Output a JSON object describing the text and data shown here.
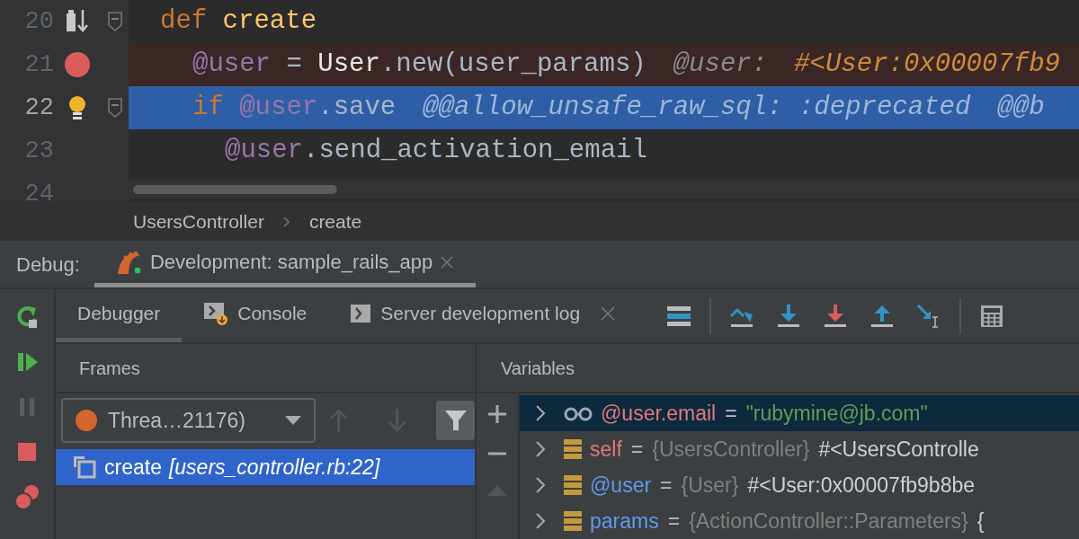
{
  "editor": {
    "lines": [
      {
        "number": "20",
        "kind": "execution-point",
        "current": false,
        "breakpoint": false,
        "foldable": true,
        "tokens": [
          {
            "kind": "keyword",
            "text": "def"
          },
          {
            "kind": "method",
            "text": " create"
          }
        ],
        "children": [
          {
            "number": "21",
            "current": false,
            "breakpoint": true,
            "foldable": false,
            "tokens": [
              {
                "kind": "ivar",
                "text": "@user"
              },
              {
                "kind": "plain",
                "text": " = "
              },
              {
                "kind": "const",
                "text": "User"
              },
              {
                "kind": "plain",
                "text": ".new(user_params)"
              }
            ],
            "hints": [
              {
                "kind": "name",
                "text": "@user:"
              },
              {
                "kind": "value",
                "text": "#<User:0x00007fb9"
              }
            ]
          },
          {
            "number": "22",
            "kind": "intention",
            "current": true,
            "breakpoint": false,
            "foldable": true,
            "tokens": [
              {
                "kind": "keyword",
                "text": "if "
              },
              {
                "kind": "ivar",
                "text": "@user"
              },
              {
                "kind": "plain",
                "text": ".save"
              }
            ],
            "hints": [
              {
                "kind": "name",
                "text": "@@allow_unsafe_raw_sql: :deprecated"
              },
              {
                "kind": "name",
                "text": "@@b"
              }
            ],
            "children": [
              {
                "number": "23",
                "current": false,
                "breakpoint": false,
                "foldable": false,
                "tokens": [
                  {
                    "kind": "ivar",
                    "text": "@user"
                  },
                  {
                    "kind": "plain",
                    "text": ".send_activation_email"
                  }
                ]
              }
            ]
          }
        ]
      },
      {
        "number": "24",
        "current": false,
        "breakpoint": false,
        "foldable": false
      }
    ]
  },
  "breadcrumbs": [
    "UsersController",
    "create"
  ],
  "debug": {
    "label": "Debug:",
    "sessions": [
      {
        "title": "Development: sample_rails_app",
        "selected": true,
        "running": true
      }
    ]
  },
  "side_toolbar": [
    {
      "kind": "rerun",
      "disabled": false
    },
    {
      "kind": "resume",
      "disabled": false
    },
    {
      "kind": "pause",
      "disabled": true
    },
    {
      "kind": "stop",
      "disabled": false
    },
    {
      "kind": "breakpoints",
      "disabled": false
    }
  ],
  "tabs": [
    {
      "label": "Debugger",
      "kind": "plain",
      "selected": true,
      "closable": false
    },
    {
      "label": "Console",
      "kind": "console",
      "selected": false,
      "closable": false
    },
    {
      "label": "Server development log",
      "kind": "log",
      "selected": false,
      "closable": true
    }
  ],
  "toolbar": [
    {
      "kind": "frames"
    },
    {
      "kind": "separator"
    },
    {
      "kind": "step-over"
    },
    {
      "kind": "step-into"
    },
    {
      "kind": "force-step-into"
    },
    {
      "kind": "step-out"
    },
    {
      "kind": "run-to-cursor"
    },
    {
      "kind": "separator"
    },
    {
      "kind": "evaluate"
    }
  ],
  "frames": {
    "title": "Frames",
    "thread": "Threa…21176)",
    "filter_on": true,
    "items": [
      {
        "method": "create",
        "location": "[users_controller.rb:22]",
        "selected": true
      }
    ]
  },
  "variables": {
    "title": "Variables",
    "items": [
      {
        "kind": "watch",
        "name": "@user.email",
        "color": "#e07a78",
        "sign": "=",
        "value": "\"rubymine@jb.com\"",
        "selected": true
      },
      {
        "kind": "field",
        "name": "self",
        "color": "#e07a78",
        "sign": "=",
        "type": "{UsersController}",
        "value": "#<UsersControlle",
        "selected": false
      },
      {
        "kind": "field",
        "name": "@user",
        "color": "#5c9ded",
        "sign": "=",
        "type": "{User}",
        "value": "#<User:0x00007fb9b8be",
        "selected": false
      },
      {
        "kind": "field",
        "name": "params",
        "color": "#5c9ded",
        "sign": "=",
        "type": "{ActionController::Parameters}",
        "value": "{",
        "selected": false
      }
    ]
  }
}
